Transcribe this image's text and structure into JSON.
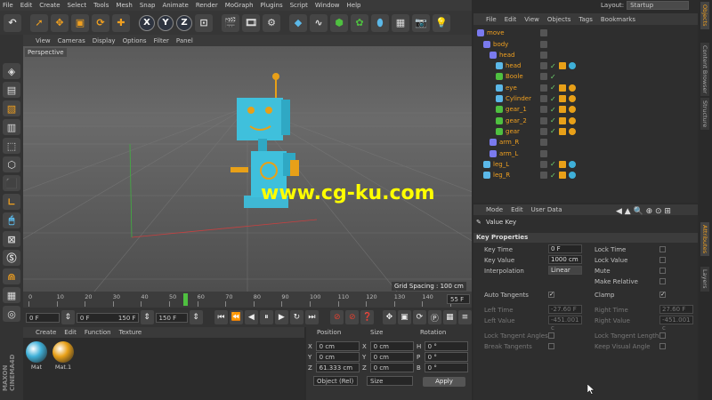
{
  "menubar": {
    "items": [
      "File",
      "Edit",
      "Create",
      "Select",
      "Tools",
      "Mesh",
      "Snap",
      "Animate",
      "Render",
      "MoGraph",
      "Plugins",
      "Script",
      "Window",
      "Help"
    ],
    "layout_label": "Layout:",
    "layout_value": "Startup"
  },
  "toolbar": {
    "axis_x": "X",
    "axis_y": "Y",
    "axis_z": "Z"
  },
  "viewport": {
    "menu": [
      "View",
      "Cameras",
      "Display",
      "Options",
      "Filter",
      "Panel"
    ],
    "label": "Perspective",
    "grid_spacing": "Grid Spacing : 100 cm",
    "watermark": "www.cg-ku.com"
  },
  "timeline": {
    "ticks": [
      "0",
      "10",
      "20",
      "30",
      "40",
      "50",
      "60",
      "70",
      "80",
      "90",
      "100",
      "110",
      "120",
      "130",
      "140",
      "15"
    ],
    "current_frame": "55 F",
    "start_field": "0 F",
    "min_field": "0 F",
    "max_field": "150 F",
    "end_field": "150 F"
  },
  "materials": {
    "menu": [
      "Create",
      "Edit",
      "Function",
      "Texture"
    ],
    "items": [
      {
        "name": "Mat",
        "color": "#3fb0d8"
      },
      {
        "name": "Mat.1",
        "color": "#e8a018"
      }
    ]
  },
  "coordinates": {
    "headers": {
      "position": "Position",
      "size": "Size",
      "rotation": "Rotation"
    },
    "rows": [
      {
        "axis": "X",
        "pos": "0 cm",
        "size_axis": "X",
        "size": "0 cm",
        "rot_axis": "H",
        "rot": "0 °"
      },
      {
        "axis": "Y",
        "pos": "0 cm",
        "size_axis": "Y",
        "size": "0 cm",
        "rot_axis": "P",
        "rot": "0 °"
      },
      {
        "axis": "Z",
        "pos": "61.333 cm",
        "size_axis": "Z",
        "size": "0 cm",
        "rot_axis": "B",
        "rot": "0 °"
      }
    ],
    "mode": "Object (Rel)",
    "size_mode": "Size",
    "apply": "Apply"
  },
  "object_manager": {
    "menu": [
      "File",
      "Edit",
      "View",
      "Objects",
      "Tags",
      "Bookmarks"
    ],
    "objects": [
      {
        "name": "move",
        "indent": 0,
        "icon": "#7a7aee",
        "tags": "none"
      },
      {
        "name": "body",
        "indent": 1,
        "icon": "#7a7aee",
        "tags": "none"
      },
      {
        "name": "head",
        "indent": 2,
        "icon": "#7a7aee",
        "tags": "none"
      },
      {
        "name": "head",
        "indent": 3,
        "icon": "#5bb8e8",
        "tags": "blue"
      },
      {
        "name": "Boole",
        "indent": 3,
        "icon": "#4fc040",
        "tags": "check"
      },
      {
        "name": "eye",
        "indent": 3,
        "icon": "#5bb8e8",
        "tags": "orange"
      },
      {
        "name": "Cylinder",
        "indent": 3,
        "icon": "#5bb8e8",
        "tags": "orange"
      },
      {
        "name": "gear_1",
        "indent": 3,
        "icon": "#4fc040",
        "tags": "orange"
      },
      {
        "name": "gear_2",
        "indent": 3,
        "icon": "#4fc040",
        "tags": "orange"
      },
      {
        "name": "gear",
        "indent": 3,
        "icon": "#4fc040",
        "tags": "orange"
      },
      {
        "name": "arm_R",
        "indent": 2,
        "icon": "#7a7aee",
        "tags": "none"
      },
      {
        "name": "arm_L",
        "indent": 2,
        "icon": "#7a7aee",
        "tags": "none"
      },
      {
        "name": "leg_L",
        "indent": 1,
        "icon": "#5bb8e8",
        "tags": "blue"
      },
      {
        "name": "leg_R",
        "indent": 1,
        "icon": "#5bb8e8",
        "tags": "blue"
      }
    ]
  },
  "attribute_manager": {
    "menu": [
      "Mode",
      "Edit",
      "User Data"
    ],
    "title": "Value Key",
    "section": "Key Properties",
    "fields": {
      "key_time_label": "Key Time",
      "key_time": "0 F",
      "key_value_label": "Key Value",
      "key_value": "1000 cm",
      "interpolation_label": "Interpolation",
      "interpolation": "Linear",
      "lock_time": "Lock Time",
      "lock_value": "Lock Value",
      "mute": "Mute",
      "make_relative": "Make Relative",
      "auto_tangents": "Auto Tangents",
      "clamp": "Clamp",
      "left_time_label": "Left Time",
      "left_time": "-27.60 F",
      "right_time_label": "Right Time",
      "right_time": "27.60 F",
      "left_value_label": "Left Value",
      "left_value": "-451.001 c",
      "right_value_label": "Right Value",
      "right_value": "-451.001 c",
      "lock_tangent_angles": "Lock Tangent Angles",
      "lock_tangent_lengths": "Lock Tangent Lengths",
      "break_tangents": "Break Tangents",
      "keep_visual_angle": "Keep Visual Angle"
    }
  },
  "right_tabs": [
    "Objects",
    "Content Browser",
    "Structure",
    "Attributes",
    "Layers"
  ]
}
